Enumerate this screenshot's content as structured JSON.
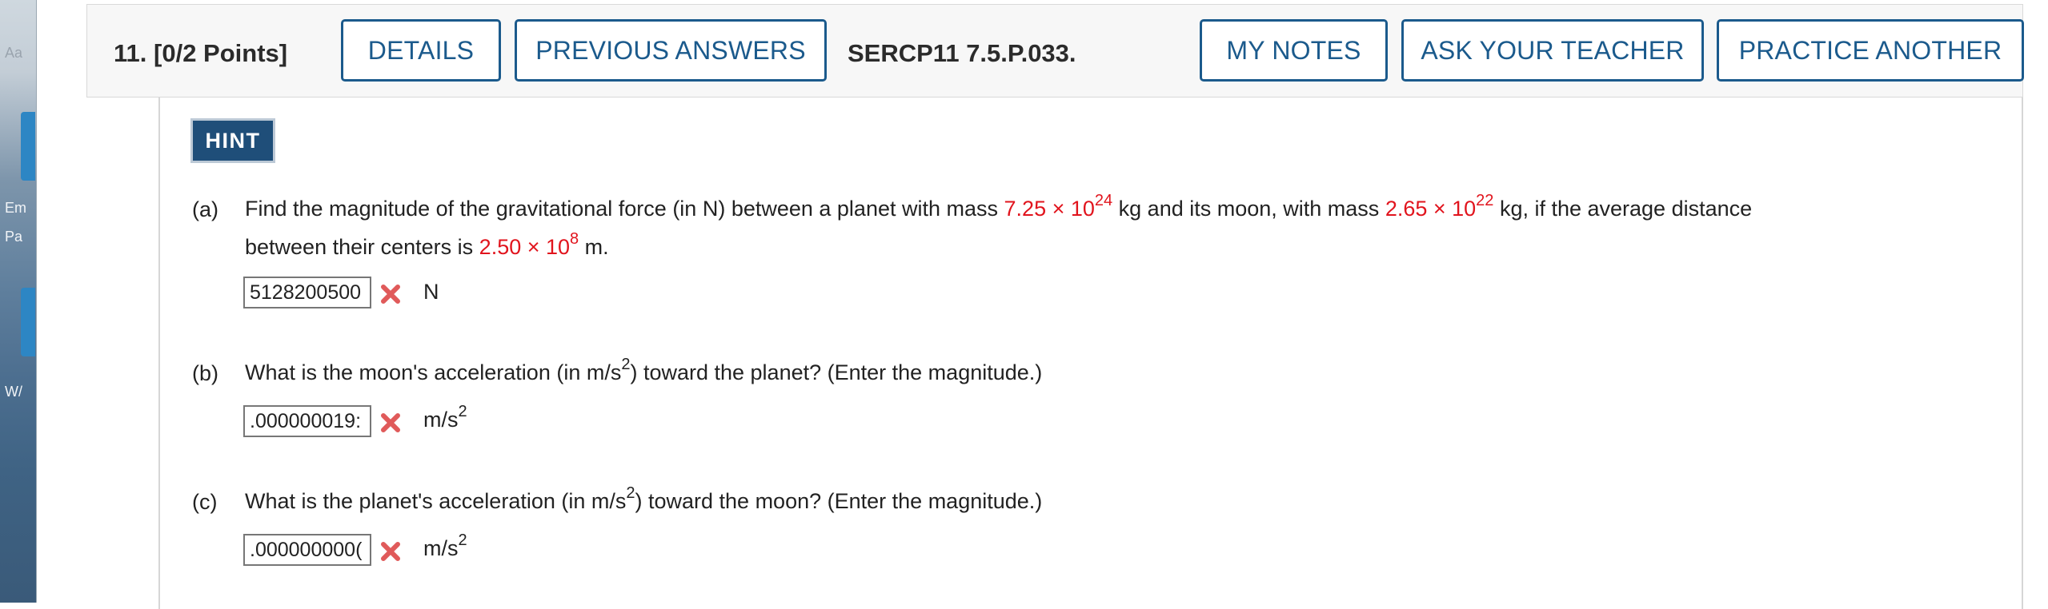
{
  "background_window": {
    "fragments": [
      "Aa",
      "Em",
      "Pa",
      "W/"
    ]
  },
  "header": {
    "question_number": "11.",
    "points": "[0/2 Points]",
    "buttons": {
      "details": "DETAILS",
      "previous_answers": "PREVIOUS ANSWERS",
      "my_notes": "MY NOTES",
      "ask_teacher": "ASK YOUR TEACHER",
      "practice_another": "PRACTICE ANOTHER"
    },
    "question_code": "SERCP11 7.5.P.033."
  },
  "hint_label": "HINT",
  "parts": {
    "a": {
      "label": "(a)",
      "text_1": "Find the magnitude of the gravitational force (in N) between a planet with mass",
      "planet_mass": "7.25 × 10",
      "planet_mass_exp": "24",
      "text_2": "kg and its moon, with mass",
      "moon_mass": "2.65 × 10",
      "moon_mass_exp": "22",
      "text_3": "kg, if the average distance",
      "text_4": "between their centers is",
      "distance": "2.50 × 10",
      "distance_exp": "8",
      "text_5": "m.",
      "answer_value": "5128200500",
      "unit": "N"
    },
    "b": {
      "label": "(b)",
      "text_1": "What is the moon's acceleration (in m/s",
      "exp": "2",
      "text_2": ") toward the planet? (Enter the magnitude.)",
      "answer_value": ".000000019:",
      "unit": "m/s",
      "unit_exp": "2"
    },
    "c": {
      "label": "(c)",
      "text_1": "What is the planet's acceleration (in m/s",
      "exp": "2",
      "text_2": ") toward the moon? (Enter the magnitude.)",
      "answer_value": ".000000000(",
      "unit": "m/s",
      "unit_exp": "2"
    }
  },
  "colors": {
    "accent_blue": "#1b5a8c",
    "hint_bg": "#1f4e79",
    "given_value_red": "#e1141d",
    "incorrect_mark": "#e05a5a"
  },
  "icons": {
    "incorrect": "x-mark-icon"
  }
}
